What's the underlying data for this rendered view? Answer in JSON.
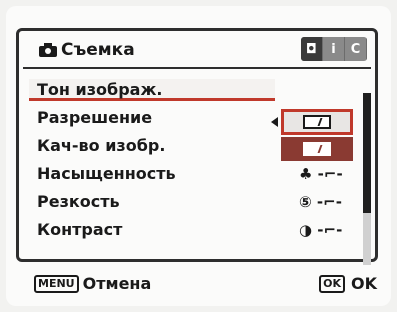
{
  "menu": {
    "title": "Съемка",
    "tabs": [
      "◘",
      "i",
      "C"
    ],
    "items": [
      {
        "label": "Тон изображ.",
        "value": "",
        "selected": true
      },
      {
        "label": "Разрешение",
        "value": ""
      },
      {
        "label": "Кач-во изобр.",
        "value": "★★★"
      },
      {
        "label": "Насыщенность",
        "value": "♣ -⌐-"
      },
      {
        "label": "Резкость",
        "value": "⑤ -⌐-"
      },
      {
        "label": "Контраст",
        "value": "◑ -⌐-"
      }
    ],
    "tone_options": [
      "camera-tone-bright",
      "camera-tone-natural"
    ]
  },
  "footer": {
    "menu_key": "MENU",
    "cancel_label": "Отмена",
    "ok_key": "OK",
    "ok_label": "OK"
  },
  "colors": {
    "accent": "#c0392b",
    "panel_border": "#2e2e2e"
  }
}
